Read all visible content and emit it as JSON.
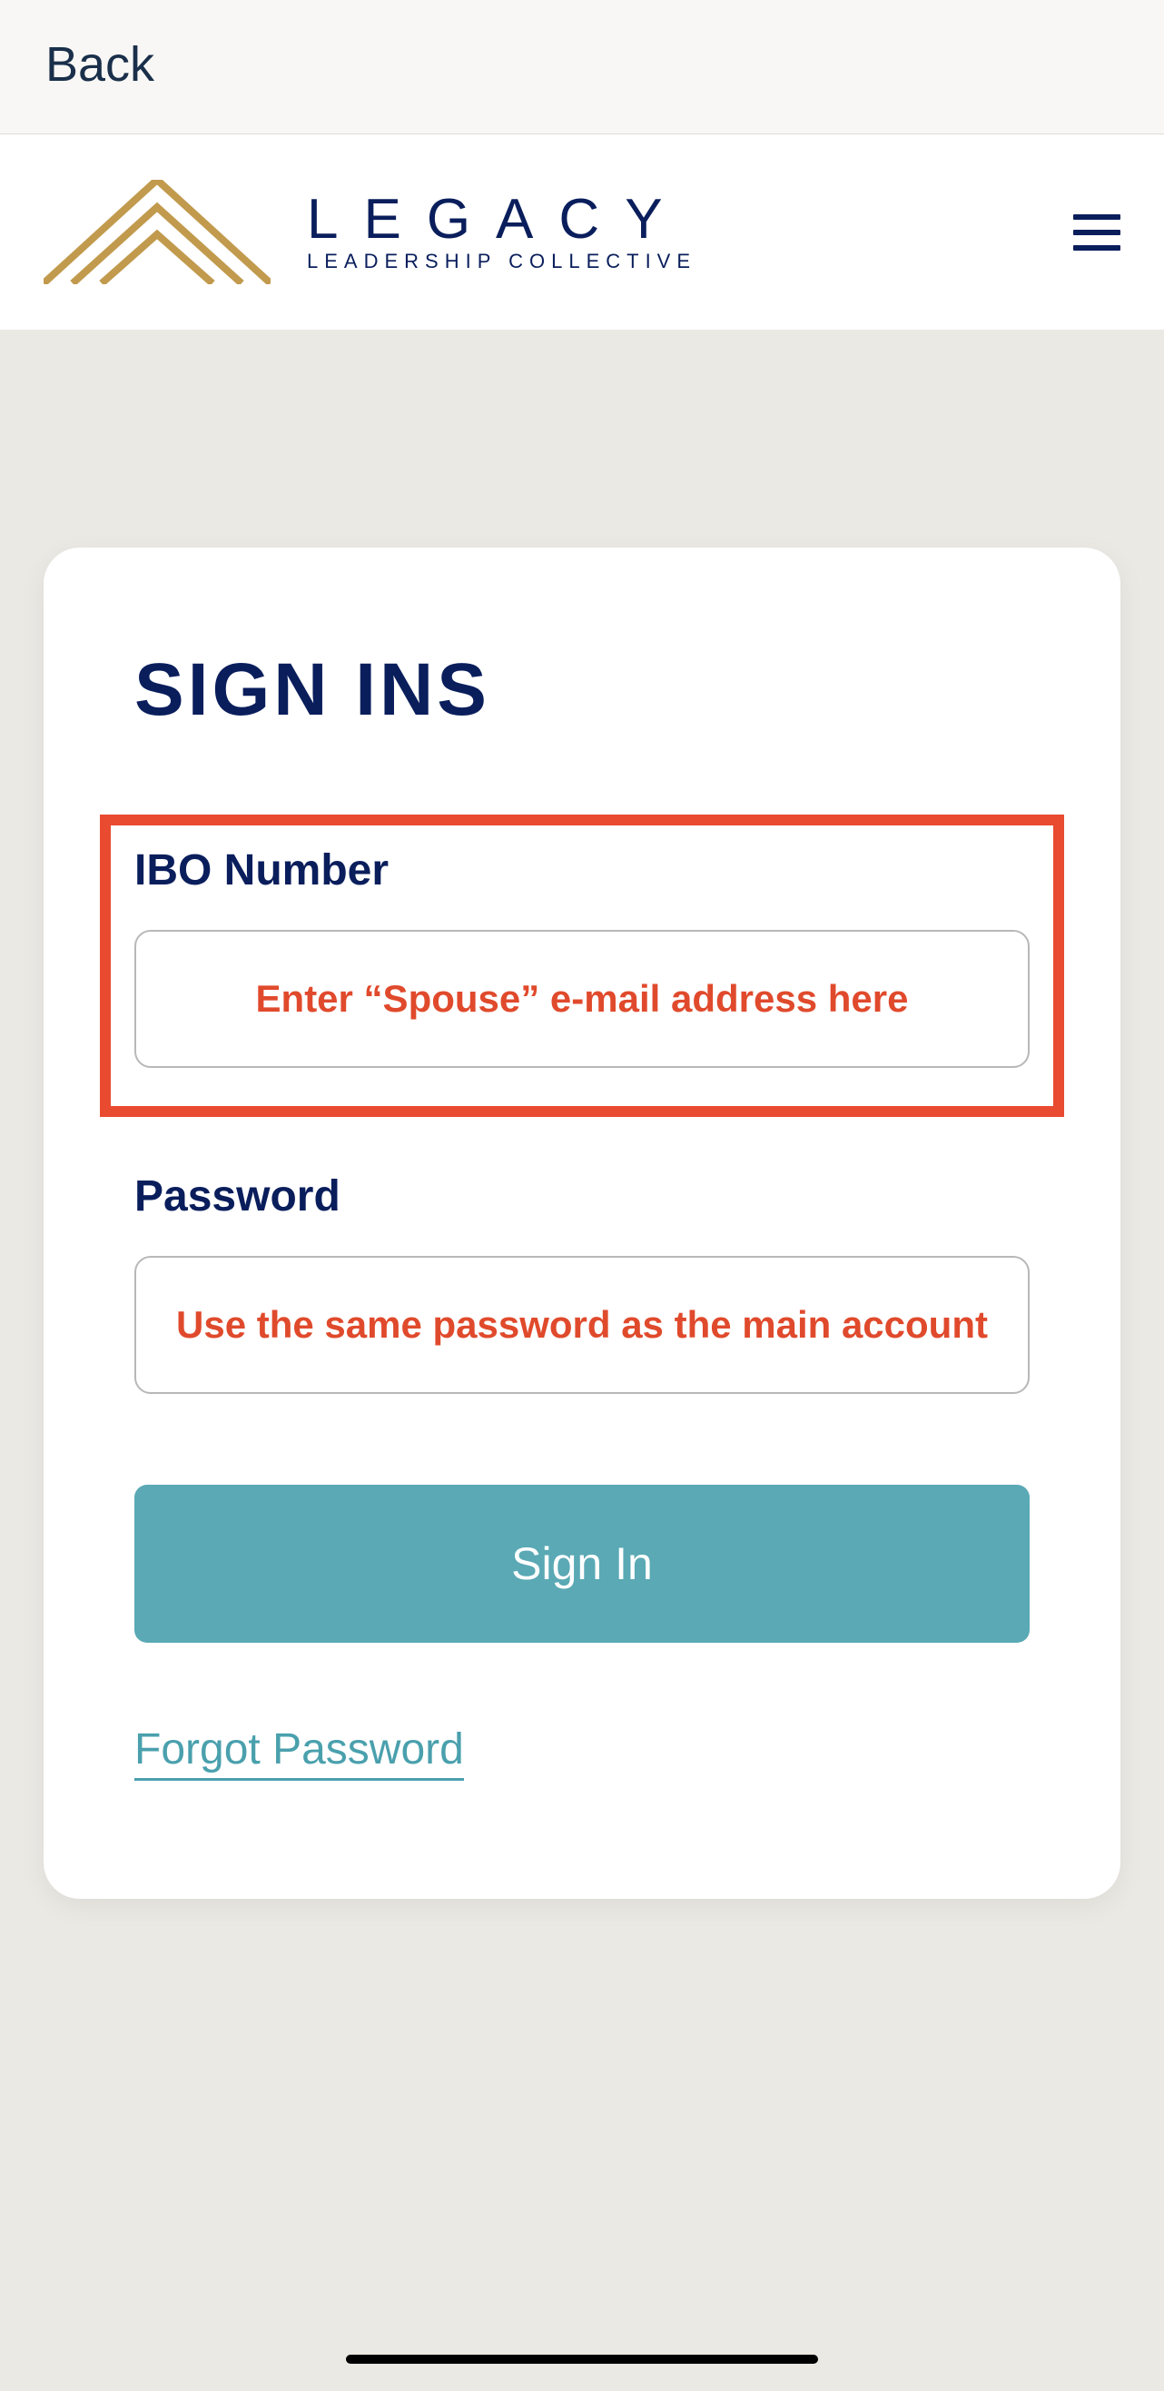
{
  "nav": {
    "back_label": "Back"
  },
  "logo": {
    "title": "LEGACY",
    "subtitle": "LEADERSHIP COLLECTIVE"
  },
  "signin": {
    "title": "SIGN INS",
    "ibo_label": "IBO Number",
    "ibo_placeholder": "Enter “Spouse” e-mail address here",
    "password_label": "Password",
    "password_placeholder": "Use the same password as the main account",
    "button_label": "Sign In",
    "forgot_label": "Forgot Password"
  },
  "colors": {
    "brand_navy": "#0a1e5c",
    "brand_gold": "#c19a4d",
    "accent_red": "#e94b30",
    "button_teal": "#5aa9b5"
  }
}
